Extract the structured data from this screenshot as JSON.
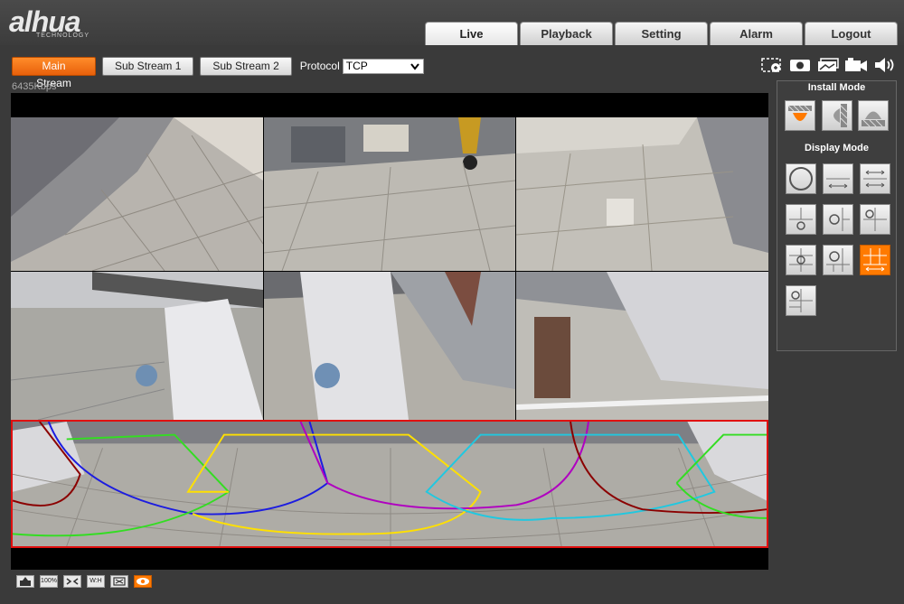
{
  "brand": {
    "name": "alhua",
    "tagline": "TECHNOLOGY"
  },
  "nav": {
    "tabs": [
      {
        "label": "Live",
        "active": true
      },
      {
        "label": "Playback",
        "active": false
      },
      {
        "label": "Setting",
        "active": false
      },
      {
        "label": "Alarm",
        "active": false
      },
      {
        "label": "Logout",
        "active": false
      }
    ]
  },
  "streams": {
    "main": "Main Stream",
    "sub1": "Sub Stream 1",
    "sub2": "Sub Stream 2",
    "protocol_label": "Protocol",
    "protocol_value": "TCP"
  },
  "toolbar_icons": [
    "zoom-region-icon",
    "snapshot-icon",
    "triple-snapshot-icon",
    "record-icon",
    "audio-icon"
  ],
  "bitrate": "6435Kbps",
  "bottom_icons": [
    {
      "name": "install-icon",
      "text": ""
    },
    {
      "name": "zoom-100-icon",
      "text": "100%"
    },
    {
      "name": "fit-screen-icon",
      "text": ""
    },
    {
      "name": "ratio-icon",
      "text": "W:H"
    },
    {
      "name": "fullscreen-icon",
      "text": ""
    },
    {
      "name": "eye-icon",
      "text": ""
    }
  ],
  "panel": {
    "install_mode_title": "Install Mode",
    "display_mode_title": "Display Mode",
    "install_modes": [
      "ceiling-mount-icon",
      "wall-mount-icon",
      "ground-mount-icon"
    ],
    "display_modes": [
      "fisheye-circle",
      "panorama-180",
      "dual-panorama",
      "1p-plus-1",
      "1p-plus-2",
      "1p-plus-3",
      "1p-plus-4",
      "1p-plus-6",
      "1p-plus-8",
      "1o-plus-3"
    ]
  },
  "colors": {
    "accent": "#ff7a00",
    "selected_window": "#3fdc2a",
    "panorama_border": "#e01010"
  }
}
